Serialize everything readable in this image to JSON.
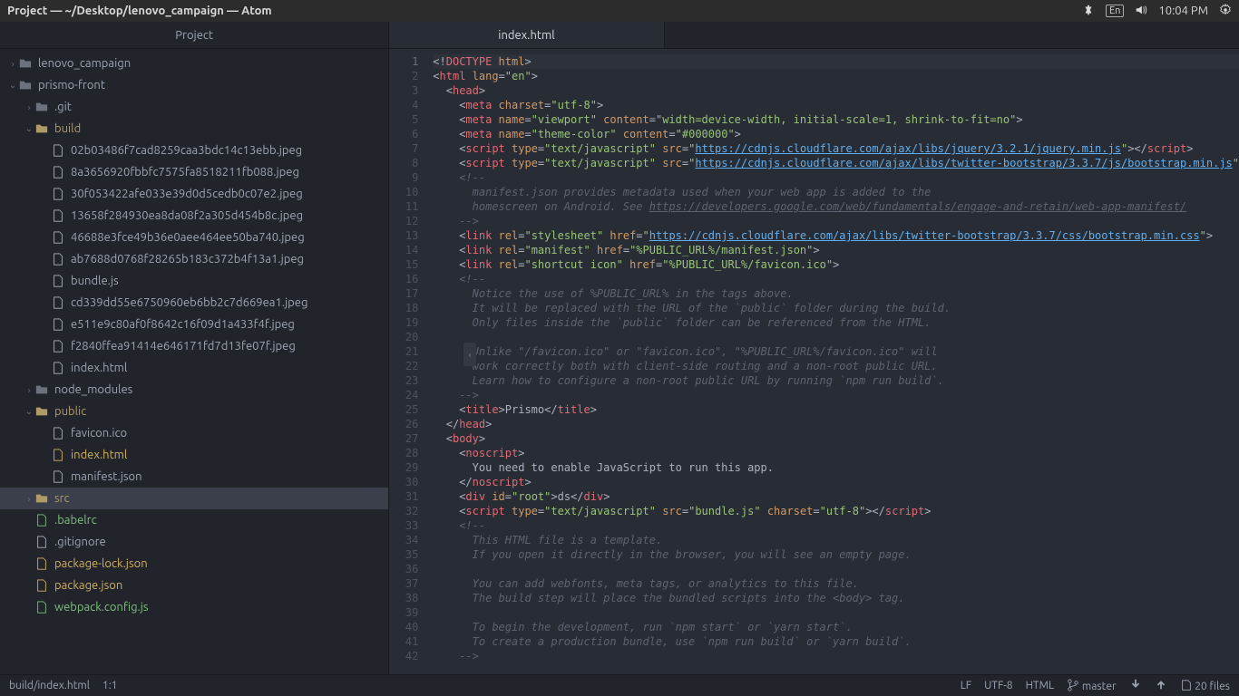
{
  "menubar": {
    "title": "Project — ~/Desktop/lenovo_campaign — Atom",
    "lang": "En",
    "time": "10:04 PM"
  },
  "sidebar": {
    "header": "Project"
  },
  "tree": [
    {
      "d": 0,
      "t": "folder",
      "c": "closed",
      "label": "lenovo_campaign"
    },
    {
      "d": 0,
      "t": "folder",
      "c": "open",
      "label": "prismo-front",
      "root": true
    },
    {
      "d": 1,
      "t": "folder",
      "c": "closed",
      "label": ".git"
    },
    {
      "d": 1,
      "t": "folder",
      "c": "open",
      "label": "build",
      "open": true
    },
    {
      "d": 2,
      "t": "file",
      "label": "02b03486f7cad8259caa3bdc14c13ebb.jpeg"
    },
    {
      "d": 2,
      "t": "file",
      "label": "8a3656920fbbfc7575fa8518211fb088.jpeg"
    },
    {
      "d": 2,
      "t": "file",
      "label": "30f053422afe033e39d0d5cedb0c07e2.jpeg"
    },
    {
      "d": 2,
      "t": "file",
      "label": "13658f284930ea8da08f2a305d454b8c.jpeg"
    },
    {
      "d": 2,
      "t": "file",
      "label": "46688e3fce49b36e0aee464ee50ba740.jpeg"
    },
    {
      "d": 2,
      "t": "file",
      "label": "ab7688d0768f28265b183c372b4f13a1.jpeg"
    },
    {
      "d": 2,
      "t": "file",
      "label": "bundle.js"
    },
    {
      "d": 2,
      "t": "file",
      "label": "cd339dd55e6750960eb6bb2c7d669ea1.jpeg"
    },
    {
      "d": 2,
      "t": "file",
      "label": "e511e9c80af0f8642c16f09d1a433f4f.jpeg"
    },
    {
      "d": 2,
      "t": "file",
      "label": "f2840ffea91414e646171fd7d13fe07f.jpeg"
    },
    {
      "d": 2,
      "t": "file",
      "label": "index.html"
    },
    {
      "d": 1,
      "t": "folder",
      "c": "closed",
      "label": "node_modules"
    },
    {
      "d": 1,
      "t": "folder",
      "c": "open",
      "label": "public",
      "open": true
    },
    {
      "d": 2,
      "t": "file",
      "label": "favicon.ico"
    },
    {
      "d": 2,
      "t": "file",
      "label": "index.html",
      "git": "modified"
    },
    {
      "d": 2,
      "t": "file",
      "label": "manifest.json"
    },
    {
      "d": 1,
      "t": "folder",
      "c": "closed",
      "label": "src",
      "open": true,
      "selected": true
    },
    {
      "d": 1,
      "t": "file",
      "label": ".babelrc",
      "git": "new"
    },
    {
      "d": 1,
      "t": "file",
      "label": ".gitignore"
    },
    {
      "d": 1,
      "t": "file",
      "label": "package-lock.json",
      "git": "modified"
    },
    {
      "d": 1,
      "t": "file",
      "label": "package.json",
      "git": "modified"
    },
    {
      "d": 1,
      "t": "file",
      "label": "webpack.config.js",
      "git": "new"
    }
  ],
  "tab": {
    "title": "index.html"
  },
  "editor": {
    "lines": [
      {
        "n": 1,
        "cursor": true,
        "seg": [
          [
            "<!",
            "p"
          ],
          [
            "DOCTYPE",
            "t"
          ],
          [
            " html",
            "a"
          ],
          [
            ">",
            "p"
          ]
        ]
      },
      {
        "n": 2,
        "seg": [
          [
            "<",
            "p"
          ],
          [
            "html",
            "t"
          ],
          [
            " lang",
            "a"
          ],
          [
            "=",
            "p"
          ],
          [
            "\"en\"",
            "s"
          ],
          [
            ">",
            "p"
          ]
        ]
      },
      {
        "n": 3,
        "seg": [
          [
            "  <",
            "p"
          ],
          [
            "head",
            "t"
          ],
          [
            ">",
            "p"
          ]
        ]
      },
      {
        "n": 4,
        "seg": [
          [
            "    <",
            "p"
          ],
          [
            "meta",
            "t"
          ],
          [
            " charset",
            "a"
          ],
          [
            "=",
            "p"
          ],
          [
            "\"utf-8\"",
            "s"
          ],
          [
            ">",
            "p"
          ]
        ]
      },
      {
        "n": 5,
        "seg": [
          [
            "    <",
            "p"
          ],
          [
            "meta",
            "t"
          ],
          [
            " name",
            "a"
          ],
          [
            "=",
            "p"
          ],
          [
            "\"viewport\"",
            "s"
          ],
          [
            " content",
            "a"
          ],
          [
            "=",
            "p"
          ],
          [
            "\"width=device-width, initial-scale=1, shrink-to-fit=no\"",
            "s"
          ],
          [
            ">",
            "p"
          ]
        ]
      },
      {
        "n": 6,
        "seg": [
          [
            "    <",
            "p"
          ],
          [
            "meta",
            "t"
          ],
          [
            " name",
            "a"
          ],
          [
            "=",
            "p"
          ],
          [
            "\"theme-color\"",
            "s"
          ],
          [
            " content",
            "a"
          ],
          [
            "=",
            "p"
          ],
          [
            "\"#000000\"",
            "s"
          ],
          [
            ">",
            "p"
          ]
        ]
      },
      {
        "n": 7,
        "seg": [
          [
            "    <",
            "p"
          ],
          [
            "script",
            "t"
          ],
          [
            " type",
            "a"
          ],
          [
            "=",
            "p"
          ],
          [
            "\"text/javascript\"",
            "s"
          ],
          [
            " src",
            "a"
          ],
          [
            "=",
            "p"
          ],
          [
            "\"",
            "s"
          ],
          [
            "https://cdnjs.cloudflare.com/ajax/libs/jquery/3.2.1/jquery.min.js",
            "l"
          ],
          [
            "\"",
            "s"
          ],
          [
            "></",
            "p"
          ],
          [
            "script",
            "t"
          ],
          [
            ">",
            "p"
          ]
        ]
      },
      {
        "n": 8,
        "seg": [
          [
            "    <",
            "p"
          ],
          [
            "script",
            "t"
          ],
          [
            " type",
            "a"
          ],
          [
            "=",
            "p"
          ],
          [
            "\"text/javascript\"",
            "s"
          ],
          [
            " src",
            "a"
          ],
          [
            "=",
            "p"
          ],
          [
            "\"",
            "s"
          ],
          [
            "https://cdnjs.cloudflare.com/ajax/libs/twitter-bootstrap/3.3.7/js/bootstrap.min.js",
            "l"
          ],
          [
            "\"",
            "s"
          ]
        ]
      },
      {
        "n": 9,
        "seg": [
          [
            "    <!--",
            "c"
          ]
        ]
      },
      {
        "n": 10,
        "seg": [
          [
            "      manifest.json provides metadata used when your web app is added to the",
            "c"
          ]
        ]
      },
      {
        "n": 11,
        "seg": [
          [
            "      homescreen on Android. See ",
            "c"
          ],
          [
            "https://developers.google.com/web/fundamentals/engage-and-retain/web-app-manifest/",
            "lc"
          ]
        ]
      },
      {
        "n": 12,
        "seg": [
          [
            "    -->",
            "c"
          ]
        ]
      },
      {
        "n": 13,
        "seg": [
          [
            "    <",
            "p"
          ],
          [
            "link",
            "t"
          ],
          [
            " rel",
            "a"
          ],
          [
            "=",
            "p"
          ],
          [
            "\"stylesheet\"",
            "s"
          ],
          [
            " href",
            "a"
          ],
          [
            "=",
            "p"
          ],
          [
            "\"",
            "s"
          ],
          [
            "https://cdnjs.cloudflare.com/ajax/libs/twitter-bootstrap/3.3.7/css/bootstrap.min.css",
            "l"
          ],
          [
            "\"",
            "s"
          ],
          [
            ">",
            "p"
          ]
        ]
      },
      {
        "n": 14,
        "seg": [
          [
            "    <",
            "p"
          ],
          [
            "link",
            "t"
          ],
          [
            " rel",
            "a"
          ],
          [
            "=",
            "p"
          ],
          [
            "\"manifest\"",
            "s"
          ],
          [
            " href",
            "a"
          ],
          [
            "=",
            "p"
          ],
          [
            "\"%PUBLIC_URL%/manifest.json\"",
            "s"
          ],
          [
            ">",
            "p"
          ]
        ]
      },
      {
        "n": 15,
        "seg": [
          [
            "    <",
            "p"
          ],
          [
            "link",
            "t"
          ],
          [
            " rel",
            "a"
          ],
          [
            "=",
            "p"
          ],
          [
            "\"shortcut icon\"",
            "s"
          ],
          [
            " href",
            "a"
          ],
          [
            "=",
            "p"
          ],
          [
            "\"%PUBLIC_URL%/favicon.ico\"",
            "s"
          ],
          [
            ">",
            "p"
          ]
        ]
      },
      {
        "n": 16,
        "seg": [
          [
            "    <!--",
            "c"
          ]
        ]
      },
      {
        "n": 17,
        "seg": [
          [
            "      Notice the use of %PUBLIC_URL% in the tags above.",
            "c"
          ]
        ]
      },
      {
        "n": 18,
        "seg": [
          [
            "      It will be replaced with the URL of the `public` folder during the build.",
            "c"
          ]
        ]
      },
      {
        "n": 19,
        "seg": [
          [
            "      Only files inside the `public` folder can be referenced from the HTML.",
            "c"
          ]
        ]
      },
      {
        "n": 20,
        "seg": [
          [
            "",
            "c"
          ]
        ]
      },
      {
        "n": 21,
        "seg": [
          [
            "      Unlike \"/favicon.ico\" or \"favicon.ico\", \"%PUBLIC_URL%/favicon.ico\" will",
            "c"
          ]
        ]
      },
      {
        "n": 22,
        "seg": [
          [
            "      work correctly both with client-side routing and a non-root public URL.",
            "c"
          ]
        ]
      },
      {
        "n": 23,
        "seg": [
          [
            "      Learn how to configure a non-root public URL by running `npm run build`.",
            "c"
          ]
        ]
      },
      {
        "n": 24,
        "seg": [
          [
            "    -->",
            "c"
          ]
        ]
      },
      {
        "n": 25,
        "seg": [
          [
            "    <",
            "p"
          ],
          [
            "title",
            "t"
          ],
          [
            ">",
            "p"
          ],
          [
            "Prismo",
            "p"
          ],
          [
            "</",
            "p"
          ],
          [
            "title",
            "t"
          ],
          [
            ">",
            "p"
          ]
        ]
      },
      {
        "n": 26,
        "seg": [
          [
            "  </",
            "p"
          ],
          [
            "head",
            "t"
          ],
          [
            ">",
            "p"
          ]
        ]
      },
      {
        "n": 27,
        "seg": [
          [
            "  <",
            "p"
          ],
          [
            "body",
            "t"
          ],
          [
            ">",
            "p"
          ]
        ]
      },
      {
        "n": 28,
        "seg": [
          [
            "    <",
            "p"
          ],
          [
            "noscript",
            "t"
          ],
          [
            ">",
            "p"
          ]
        ]
      },
      {
        "n": 29,
        "seg": [
          [
            "      You need to enable JavaScript to run this app.",
            "p"
          ]
        ]
      },
      {
        "n": 30,
        "seg": [
          [
            "    </",
            "p"
          ],
          [
            "noscript",
            "t"
          ],
          [
            ">",
            "p"
          ]
        ]
      },
      {
        "n": 31,
        "seg": [
          [
            "    <",
            "p"
          ],
          [
            "div",
            "t"
          ],
          [
            " id",
            "a"
          ],
          [
            "=",
            "p"
          ],
          [
            "\"root\"",
            "s"
          ],
          [
            ">",
            "p"
          ],
          [
            "ds",
            "p"
          ],
          [
            "</",
            "p"
          ],
          [
            "div",
            "t"
          ],
          [
            ">",
            "p"
          ]
        ]
      },
      {
        "n": 32,
        "seg": [
          [
            "    <",
            "p"
          ],
          [
            "script",
            "t"
          ],
          [
            " type",
            "a"
          ],
          [
            "=",
            "p"
          ],
          [
            "\"text/javascript\"",
            "s"
          ],
          [
            " src",
            "a"
          ],
          [
            "=",
            "p"
          ],
          [
            "\"bundle.js\"",
            "s"
          ],
          [
            " charset",
            "a"
          ],
          [
            "=",
            "p"
          ],
          [
            "\"utf-8\"",
            "s"
          ],
          [
            "></",
            "p"
          ],
          [
            "script",
            "t"
          ],
          [
            ">",
            "p"
          ]
        ]
      },
      {
        "n": 33,
        "seg": [
          [
            "    <!--",
            "c"
          ]
        ]
      },
      {
        "n": 34,
        "seg": [
          [
            "      This HTML file is a template.",
            "c"
          ]
        ]
      },
      {
        "n": 35,
        "seg": [
          [
            "      If you open it directly in the browser, you will see an empty page.",
            "c"
          ]
        ]
      },
      {
        "n": 36,
        "seg": [
          [
            "",
            "c"
          ]
        ]
      },
      {
        "n": 37,
        "seg": [
          [
            "      You can add webfonts, meta tags, or analytics to this file.",
            "c"
          ]
        ]
      },
      {
        "n": 38,
        "seg": [
          [
            "      The build step will place the bundled scripts into the <body> tag.",
            "c"
          ]
        ]
      },
      {
        "n": 39,
        "seg": [
          [
            "",
            "c"
          ]
        ]
      },
      {
        "n": 40,
        "seg": [
          [
            "      To begin the development, run `npm start` or `yarn start`.",
            "c"
          ]
        ]
      },
      {
        "n": 41,
        "seg": [
          [
            "      To create a production bundle, use `npm run build` or `yarn build`.",
            "c"
          ]
        ]
      },
      {
        "n": 42,
        "seg": [
          [
            "    -->",
            "c"
          ]
        ]
      }
    ]
  },
  "statusbar": {
    "path": "build/index.html",
    "pos": "1:1",
    "eol": "LF",
    "enc": "UTF-8",
    "lang": "HTML",
    "branch": "master",
    "files": "20 files"
  }
}
